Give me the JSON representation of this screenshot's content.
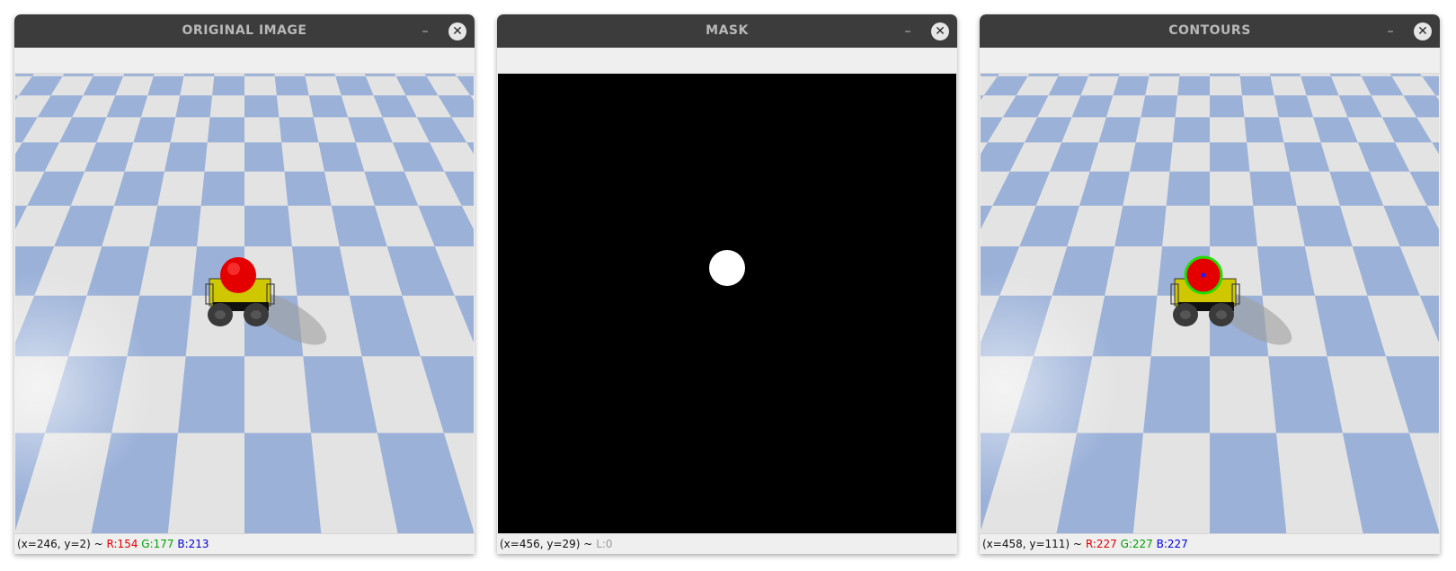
{
  "windows": [
    {
      "title": "ORIGINAL IMAGE",
      "status": {
        "coords": "(x=246, y=2) ~",
        "r": "R:154",
        "g": "G:177",
        "b": "B:213"
      }
    },
    {
      "title": "MASK",
      "status": {
        "coords": "(x=456, y=29) ~",
        "l": "L:0"
      }
    },
    {
      "title": "CONTOURS",
      "status": {
        "coords": "(x=458, y=111) ~",
        "r": "R:227",
        "g": "G:227",
        "b": "B:227"
      }
    }
  ],
  "controls": {
    "minimize": "–",
    "close": "✕"
  },
  "colors": {
    "checker_blue": "#9bb1d8",
    "checker_white": "#e3e3e3",
    "ball_red": "#e50000",
    "contour_green": "#22dd00",
    "mask_bg": "#000000",
    "mask_blob": "#ffffff"
  }
}
